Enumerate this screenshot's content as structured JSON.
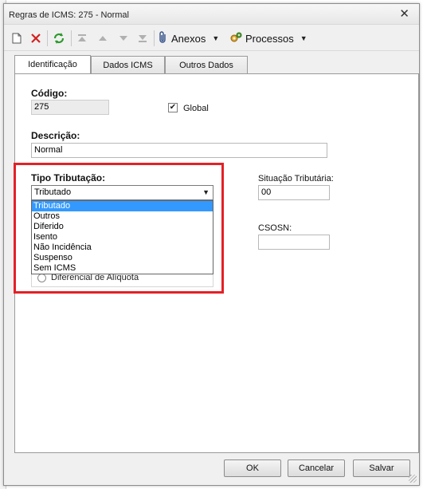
{
  "window": {
    "title": "Regras de ICMS: 275 - Normal",
    "close_label": "✕"
  },
  "toolbar": {
    "anexos_label": "Anexos",
    "processos_label": "Processos"
  },
  "tabs": [
    {
      "label": "Identificação"
    },
    {
      "label": "Dados ICMS"
    },
    {
      "label": "Outros Dados"
    }
  ],
  "form": {
    "codigo_label": "Código:",
    "codigo_value": "275",
    "global_label": "Global",
    "global_checked": true,
    "descricao_label": "Descrição:",
    "descricao_value": "Normal",
    "tipo_label": "Tipo Tributação:",
    "tipo_selected": "Tributado",
    "tipo_options": [
      "Tributado",
      "Outros",
      "Diferido",
      "Isento",
      "Não Incidência",
      "Suspenso",
      "Sem ICMS"
    ],
    "situacao_label": "Situação Tributária:",
    "situacao_value": "00",
    "csosn_label": "CSOSN:",
    "csosn_value": "",
    "radio_label": "Diferencial de Alíquota"
  },
  "buttons": {
    "ok": "OK",
    "cancel": "Cancelar",
    "save": "Salvar"
  },
  "colors": {
    "highlight": "#e32127",
    "selection": "#3399ff"
  }
}
